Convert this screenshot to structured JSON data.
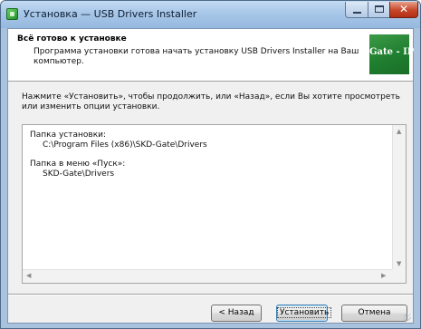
{
  "window": {
    "title": "Установка — USB Drivers Installer"
  },
  "header": {
    "title": "Всё готово к установке",
    "subtitle": "Программа установки готова начать установку USB Drivers Installer на Ваш компьютер.",
    "logo_text": "Gate - IP"
  },
  "intro_text": "Нажмите «Установить», чтобы продолжить, или «Назад», если Вы хотите просмотреть или изменить опции установки.",
  "memo": {
    "dest_label": "Папка установки:",
    "dest_value": "C:\\Program Files (x86)\\SKD-Gate\\Drivers",
    "start_label": "Папка в меню «Пуск»:",
    "start_value": "SKD-Gate\\Drivers"
  },
  "buttons": {
    "back": "< Назад",
    "install": "Установить",
    "cancel": "Отмена"
  },
  "icons": {
    "close": "✕",
    "up": "▲",
    "down": "▼",
    "left": "◀",
    "right": "▶"
  },
  "colors": {
    "accent": "#3c7fb1",
    "logo_green": "#1f7f2f",
    "close_red": "#c6462a"
  }
}
